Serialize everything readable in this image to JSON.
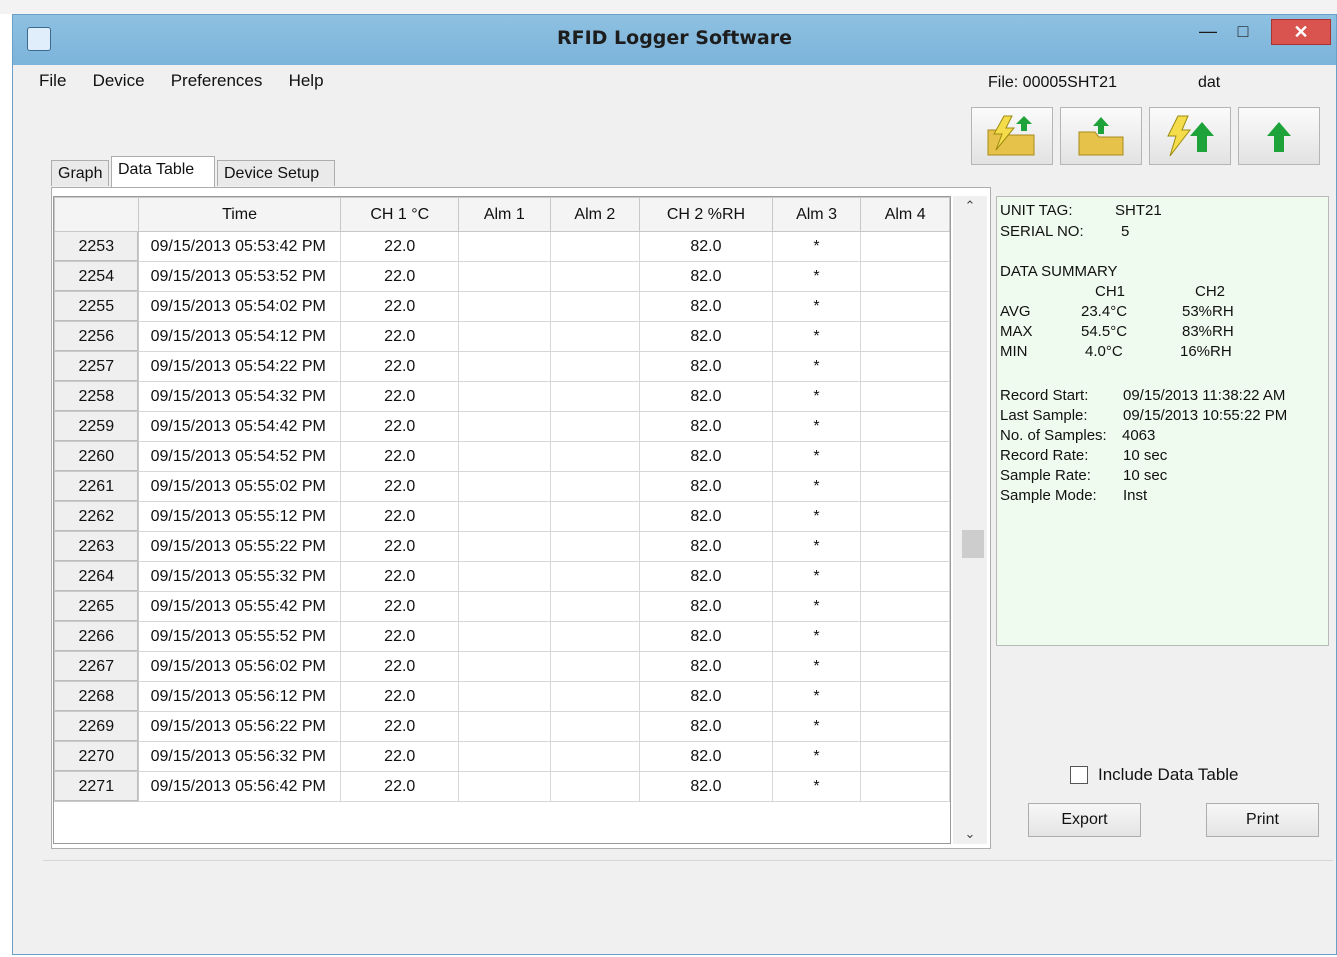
{
  "window": {
    "title": "RFID Logger Software"
  },
  "menu": [
    "File",
    "Device",
    "Preferences",
    "Help"
  ],
  "file": {
    "label": "File:  00005SHT21",
    "ext": "dat"
  },
  "toolbar": {
    "buttons": [
      {
        "name": "open-file-button",
        "icon": "folder-lightning-icon"
      },
      {
        "name": "open-folder-button",
        "icon": "folder-arrow-icon"
      },
      {
        "name": "download-button",
        "icon": "lightning-arrow-icon"
      },
      {
        "name": "upload-button",
        "icon": "green-arrow-up-icon"
      }
    ]
  },
  "tabs": [
    {
      "label": "Graph",
      "active": false
    },
    {
      "label": "Data Table",
      "active": true
    },
    {
      "label": "Device Setup",
      "active": false
    }
  ],
  "table": {
    "columns": [
      "",
      "Time",
      "CH 1 °C",
      "Alm 1",
      "Alm 2",
      "CH 2 %RH",
      "Alm 3",
      "Alm 4"
    ],
    "rows": [
      [
        "2253",
        "09/15/2013 05:53:42 PM",
        "22.0",
        "",
        "",
        "82.0",
        "*",
        ""
      ],
      [
        "2254",
        "09/15/2013 05:53:52 PM",
        "22.0",
        "",
        "",
        "82.0",
        "*",
        ""
      ],
      [
        "2255",
        "09/15/2013 05:54:02 PM",
        "22.0",
        "",
        "",
        "82.0",
        "*",
        ""
      ],
      [
        "2256",
        "09/15/2013 05:54:12 PM",
        "22.0",
        "",
        "",
        "82.0",
        "*",
        ""
      ],
      [
        "2257",
        "09/15/2013 05:54:22 PM",
        "22.0",
        "",
        "",
        "82.0",
        "*",
        ""
      ],
      [
        "2258",
        "09/15/2013 05:54:32 PM",
        "22.0",
        "",
        "",
        "82.0",
        "*",
        ""
      ],
      [
        "2259",
        "09/15/2013 05:54:42 PM",
        "22.0",
        "",
        "",
        "82.0",
        "*",
        ""
      ],
      [
        "2260",
        "09/15/2013 05:54:52 PM",
        "22.0",
        "",
        "",
        "82.0",
        "*",
        ""
      ],
      [
        "2261",
        "09/15/2013 05:55:02 PM",
        "22.0",
        "",
        "",
        "82.0",
        "*",
        ""
      ],
      [
        "2262",
        "09/15/2013 05:55:12 PM",
        "22.0",
        "",
        "",
        "82.0",
        "*",
        ""
      ],
      [
        "2263",
        "09/15/2013 05:55:22 PM",
        "22.0",
        "",
        "",
        "82.0",
        "*",
        ""
      ],
      [
        "2264",
        "09/15/2013 05:55:32 PM",
        "22.0",
        "",
        "",
        "82.0",
        "*",
        ""
      ],
      [
        "2265",
        "09/15/2013 05:55:42 PM",
        "22.0",
        "",
        "",
        "82.0",
        "*",
        ""
      ],
      [
        "2266",
        "09/15/2013 05:55:52 PM",
        "22.0",
        "",
        "",
        "82.0",
        "*",
        ""
      ],
      [
        "2267",
        "09/15/2013 05:56:02 PM",
        "22.0",
        "",
        "",
        "82.0",
        "*",
        ""
      ],
      [
        "2268",
        "09/15/2013 05:56:12 PM",
        "22.0",
        "",
        "",
        "82.0",
        "*",
        ""
      ],
      [
        "2269",
        "09/15/2013 05:56:22 PM",
        "22.0",
        "",
        "",
        "82.0",
        "*",
        ""
      ],
      [
        "2270",
        "09/15/2013 05:56:32 PM",
        "22.0",
        "",
        "",
        "82.0",
        "*",
        ""
      ],
      [
        "2271",
        "09/15/2013 05:56:42 PM",
        "22.0",
        "",
        "",
        "82.0",
        "*",
        ""
      ]
    ]
  },
  "summary": {
    "unit_tag_label": "UNIT TAG:",
    "unit_tag_value": "SHT21",
    "serial_label": "SERIAL NO:",
    "serial_value": "5",
    "data_summary_label": "DATA  SUMMARY",
    "ch1_header": "CH1",
    "ch2_header": "CH2",
    "avg_label": "AVG",
    "avg_ch1": "23.4°C",
    "avg_ch2": "53%RH",
    "max_label": "MAX",
    "max_ch1": "54.5°C",
    "max_ch2": "83%RH",
    "min_label": "MIN",
    "min_ch1": "4.0°C",
    "min_ch2": "16%RH",
    "record_start_label": "Record Start:",
    "record_start_value": "09/15/2013 11:38:22 AM",
    "last_sample_label": "Last Sample:",
    "last_sample_value": "09/15/2013 10:55:22 PM",
    "samples_label": "No. of Samples:",
    "samples_value": "4063",
    "record_rate_label": "Record Rate:",
    "record_rate_value": "10 sec",
    "sample_rate_label": "Sample Rate:",
    "sample_rate_value": "10 sec",
    "sample_mode_label": "Sample Mode:",
    "sample_mode_value": "Inst"
  },
  "include_table": {
    "label": "Include Data Table",
    "checked": false
  },
  "buttons": {
    "export": "Export",
    "print": "Print"
  },
  "colors": {
    "title_bar": "#7cb3d9",
    "close_button": "#d9534f",
    "summary_bg": "#f0fbef",
    "arrow_green": "#1ea33a",
    "folder_yellow": "#e6c24a"
  }
}
